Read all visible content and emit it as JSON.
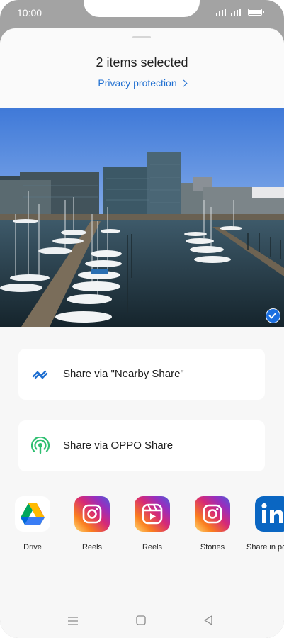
{
  "status_bar": {
    "time": "10:00"
  },
  "sheet": {
    "title": "2 items selected",
    "privacy_link": "Privacy protection"
  },
  "share_options": [
    {
      "label": "Share via \"Nearby Share\"",
      "icon": "nearby-share-icon"
    },
    {
      "label": "Share via OPPO Share",
      "icon": "oppo-share-icon"
    }
  ],
  "apps": [
    {
      "name": "Drive",
      "icon": "google-drive-icon"
    },
    {
      "name": "Reels",
      "icon": "instagram-icon"
    },
    {
      "name": "Reels",
      "icon": "instagram-reels-icon"
    },
    {
      "name": "Stories",
      "icon": "instagram-icon"
    },
    {
      "name": "Share in post",
      "icon": "linkedin-icon"
    }
  ],
  "colors": {
    "accent": "#1f6fd1",
    "check": "#1b6fe0",
    "sheet_bg": "#f7f7f7",
    "linkedin": "#0a66c2"
  },
  "nav_bar": [
    "menu-icon",
    "home-icon",
    "back-icon"
  ]
}
